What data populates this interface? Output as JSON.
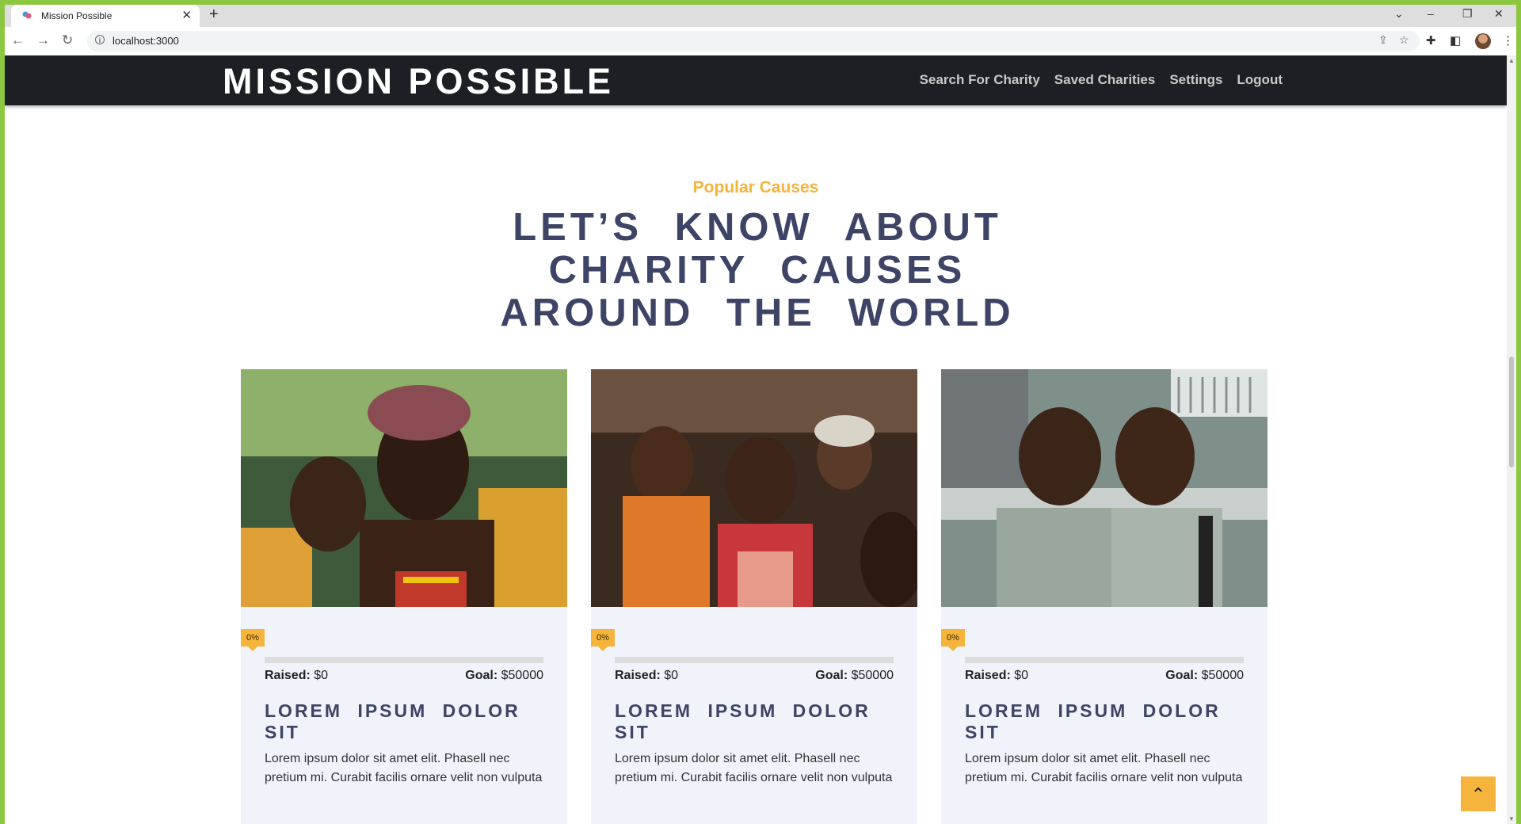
{
  "browser": {
    "tab_title": "Mission Possible",
    "url": "localhost:3000",
    "accent_color": "#8dc63f"
  },
  "nav": {
    "brand": "MISSION POSSIBLE",
    "links": [
      "Search For Charity",
      "Saved Charities",
      "Settings",
      "Logout"
    ]
  },
  "hero": {
    "eyebrow": "Popular Causes",
    "title": "Let’s know about charity causes around the world"
  },
  "cards": [
    {
      "progress": "0%",
      "progress_fraction": 0,
      "raised_label": "Raised:",
      "raised_value": "$0",
      "goal_label": "Goal:",
      "goal_value": "$50000",
      "title": "Lorem ipsum dolor sit",
      "description": "Lorem ipsum dolor sit amet elit. Phasell nec pretium mi. Curabit facilis ornare velit non vulputa",
      "image": "children-group-photo"
    },
    {
      "progress": "0%",
      "progress_fraction": 0,
      "raised_label": "Raised:",
      "raised_value": "$0",
      "goal_label": "Goal:",
      "goal_value": "$50000",
      "title": "Lorem ipsum dolor sit",
      "description": "Lorem ipsum dolor sit amet elit. Phasell nec pretium mi. Curabit facilis ornare velit non vulputa",
      "image": "smiling-girl-photo"
    },
    {
      "progress": "0%",
      "progress_fraction": 0,
      "raised_label": "Raised:",
      "raised_value": "$0",
      "goal_label": "Goal:",
      "goal_value": "$50000",
      "title": "Lorem ipsum dolor sit",
      "description": "Lorem ipsum dolor sit amet elit. Phasell nec pretium mi. Curabit facilis ornare velit non vulputa",
      "image": "two-boys-photo"
    }
  ],
  "colors": {
    "navbar": "#1e1f24",
    "accent": "#f5b43c",
    "heading": "#3d4465",
    "card_bg": "#f1f3fb"
  }
}
